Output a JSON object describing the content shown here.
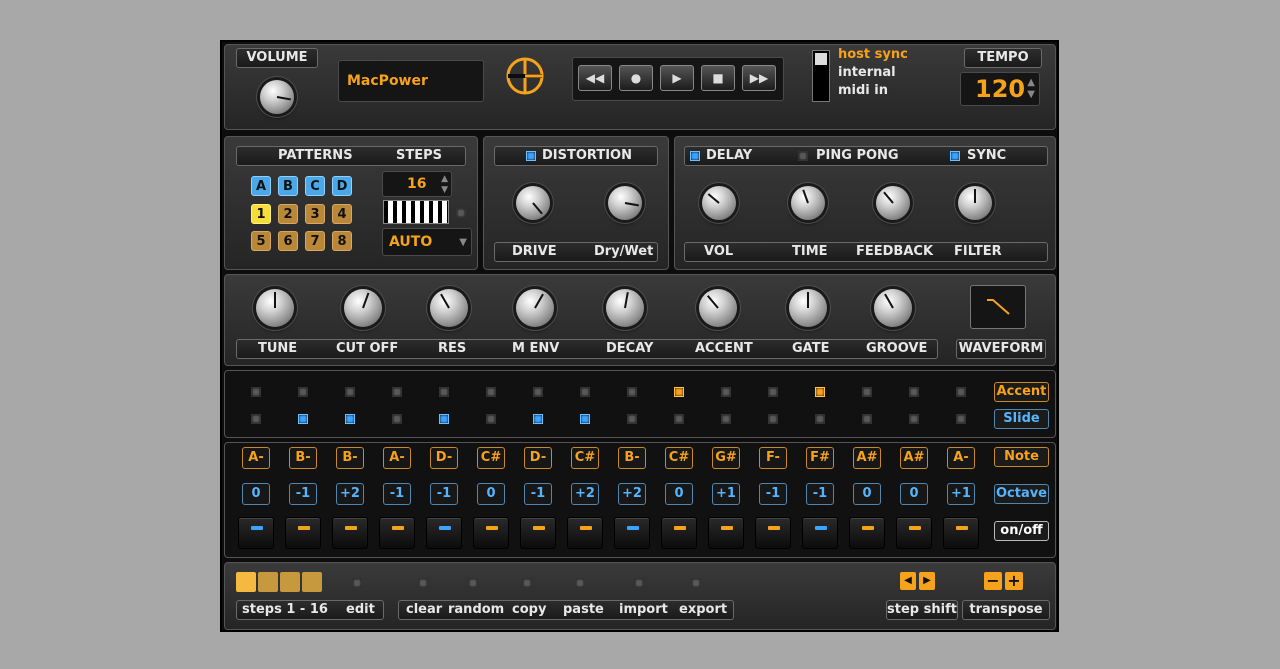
{
  "top": {
    "volume_label": "VOLUME",
    "preset_name": "MacPower",
    "transport": [
      "◀◀",
      "●",
      "▶",
      "■",
      "▶▶"
    ],
    "sync_options": [
      "host sync",
      "internal",
      "midi in"
    ],
    "tempo_label": "TEMPO",
    "tempo_value": "120"
  },
  "patterns": {
    "patterns_label": "PATTERNS",
    "steps_label": "STEPS",
    "letters": [
      "A",
      "B",
      "C",
      "D"
    ],
    "numbers": [
      "1",
      "2",
      "3",
      "4",
      "5",
      "6",
      "7",
      "8"
    ],
    "steps_value": "16",
    "mode_value": "AUTO"
  },
  "distortion": {
    "title": "DISTORTION",
    "drive_label": "DRIVE",
    "drywet_label": "Dry/Wet"
  },
  "delay": {
    "delay_label": "DELAY",
    "pingpong_label": "PING PONG",
    "sync_label": "SYNC",
    "vol_label": "VOL",
    "time_label": "TIME",
    "feedback_label": "FEEDBACK",
    "filter_label": "FILTER"
  },
  "synth": {
    "knobs": [
      "TUNE",
      "CUT OFF",
      "RES",
      "M ENV",
      "DECAY",
      "ACCENT",
      "GATE",
      "GROOVE"
    ],
    "waveform_label": "WAVEFORM"
  },
  "sequencer": {
    "accent_label": "Accent",
    "slide_label": "Slide",
    "note_label": "Note",
    "octave_label": "Octave",
    "onoff_label": "on/off",
    "accent": [
      0,
      0,
      0,
      0,
      0,
      0,
      0,
      0,
      0,
      1,
      0,
      0,
      1,
      0,
      0,
      0
    ],
    "slide": [
      0,
      1,
      1,
      0,
      1,
      0,
      1,
      1,
      0,
      0,
      0,
      0,
      0,
      0,
      0,
      0
    ],
    "notes": [
      "A-",
      "B-",
      "B-",
      "A-",
      "D-",
      "C#",
      "D-",
      "C#",
      "B-",
      "C#",
      "G#",
      "F-",
      "F#",
      "A#",
      "A#",
      "A-"
    ],
    "octaves": [
      "0",
      "-1",
      "+2",
      "-1",
      "-1",
      "0",
      "-1",
      "+2",
      "+2",
      "0",
      "+1",
      "-1",
      "-1",
      "0",
      "0",
      "+1"
    ],
    "pads": [
      "blue",
      "orange",
      "orange",
      "orange",
      "blue",
      "orange",
      "orange",
      "orange",
      "blue",
      "orange",
      "orange",
      "orange",
      "blue",
      "orange",
      "orange",
      "orange"
    ]
  },
  "bottom": {
    "steps_range": "steps 1 - 16",
    "edit": "edit",
    "clear": "clear",
    "random": "random",
    "copy": "copy",
    "paste": "paste",
    "import": "import",
    "export": "export",
    "step_shift": "step shift",
    "transpose": "transpose"
  },
  "colors": {
    "accent_orange": "#f7a21b",
    "led_blue": "#3ca3ff",
    "panel": "#2f2f2f"
  }
}
